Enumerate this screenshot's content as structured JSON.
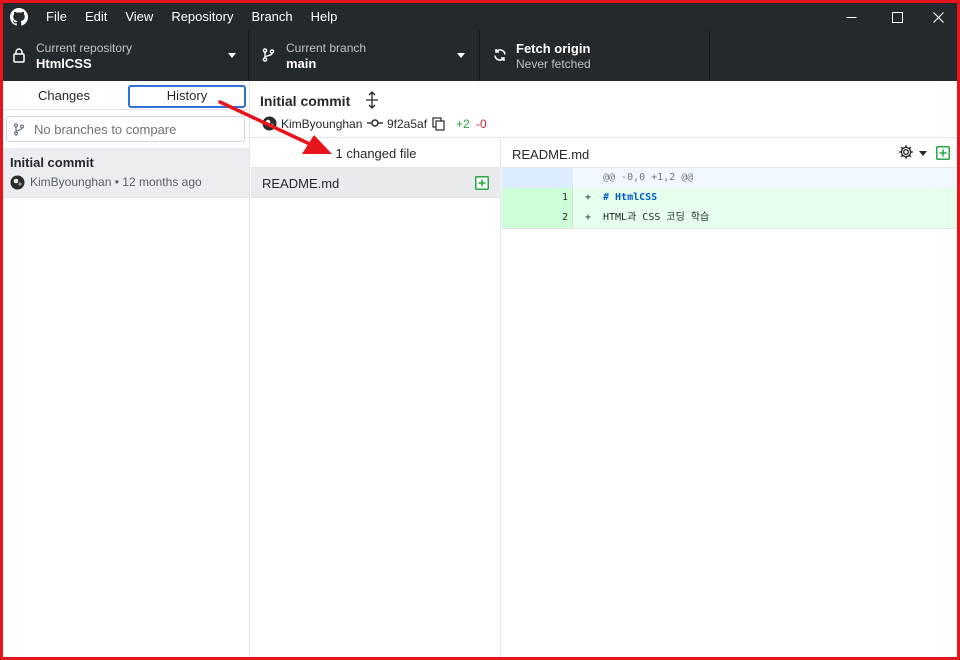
{
  "menu": [
    "File",
    "Edit",
    "View",
    "Repository",
    "Branch",
    "Help"
  ],
  "toolbar": {
    "repo": {
      "title": "Current repository",
      "value": "HtmlCSS"
    },
    "branch": {
      "title": "Current branch",
      "value": "main"
    },
    "fetch": {
      "title": "Fetch origin",
      "value": "Never fetched"
    }
  },
  "sidebar": {
    "tabs": {
      "changes": "Changes",
      "history": "History"
    },
    "branch_filter_placeholder": "No branches to compare",
    "commit": {
      "title": "Initial commit",
      "author": "KimByounghan",
      "separator": "•",
      "age": "12 months ago"
    }
  },
  "commit_header": {
    "summary": "Initial commit",
    "author": "KimByounghan",
    "sha": "9f2a5af",
    "additions": "+2",
    "deletions": "-0"
  },
  "file_list": {
    "count": "1 changed file",
    "files": [
      {
        "name": "README.md",
        "status": "added"
      }
    ]
  },
  "diff": {
    "path": "README.md",
    "hunk": "@@ -0,0 +1,2 @@",
    "lines": [
      {
        "new": "1",
        "sign": "+",
        "text": "# HtmlCSS"
      },
      {
        "new": "2",
        "sign": "+",
        "text": "HTML과 CSS 코딩 학습"
      }
    ]
  },
  "colors": {
    "annotation_arrow": "#e8141b",
    "focus_box": "#2f6fe0",
    "title_bar": "#24292e",
    "add_green": "#28a745",
    "del_red": "#cb2431"
  },
  "icons": {
    "titlebar_logo": "github-logo-icon",
    "repo": "lock-icon",
    "branch": "git-branch-icon",
    "fetch": "sync-icon",
    "window_controls": [
      "minimize-icon",
      "maximize-icon",
      "close-icon"
    ]
  }
}
